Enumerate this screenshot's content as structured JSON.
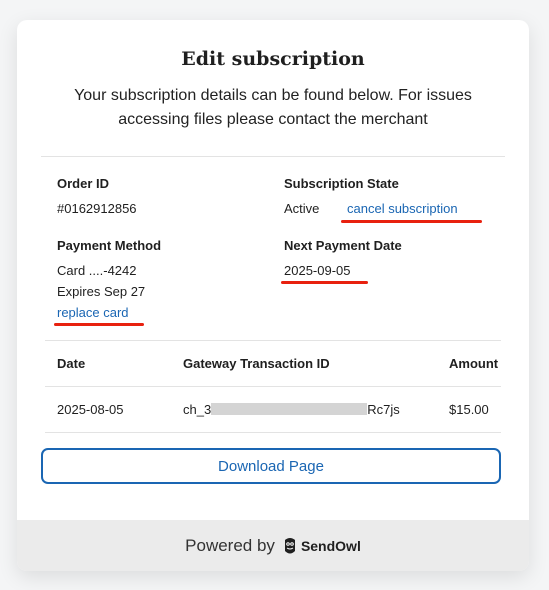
{
  "header": {
    "title": "Edit subscription",
    "subtitle": "Your subscription details can be found below. For issues accessing files please contact the merchant"
  },
  "details": {
    "order_id_label": "Order ID",
    "order_id_value": "#0162912856",
    "state_label": "Subscription State",
    "state_value": "Active",
    "cancel_link": "cancel subscription",
    "payment_method_label": "Payment Method",
    "card_value": "Card ....-4242",
    "expires_value": "Expires Sep 27",
    "replace_link": "replace card",
    "next_payment_label": "Next Payment Date",
    "next_payment_value": "2025-09-05"
  },
  "transactions": {
    "columns": [
      "Date",
      "Gateway Transaction ID",
      "Amount"
    ],
    "rows": [
      {
        "date": "2025-08-05",
        "id_prefix": "ch_3",
        "id_suffix": "Rc7js",
        "amount": "$15.00"
      }
    ]
  },
  "actions": {
    "download_label": "Download Page"
  },
  "footer": {
    "powered_by": "Powered by",
    "brand_name": "SendOwl"
  },
  "colors": {
    "link": "#1a66b3",
    "highlight": "#e8210f",
    "footer_bg": "#ebebeb"
  },
  "icons": {
    "brand_logo": "sendowl-owl-icon"
  }
}
